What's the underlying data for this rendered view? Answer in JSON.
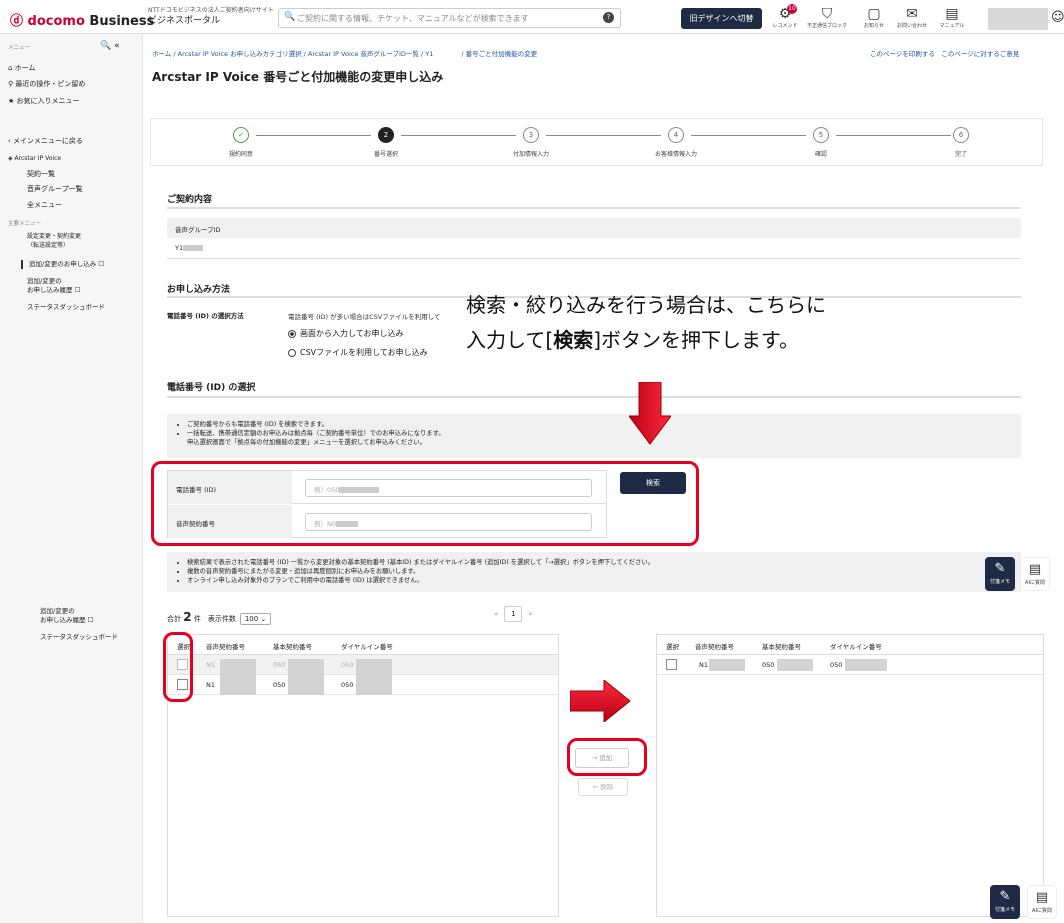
{
  "header": {
    "brand": "docomo",
    "brand_suffix": "Business",
    "tagline": "NTTドコモビジネスの法人ご契約者向けサイト",
    "portal": "ビジネスポータル",
    "search_placeholder": "ご契約に関する情報、チケット、マニュアルなどが検索できます",
    "old_design": "旧デザインへ切替",
    "icons": [
      {
        "label": "レコメンド",
        "icon": "gear-icon",
        "badge": "10"
      },
      {
        "label": "不正通信ブロック",
        "icon": "shield-icon"
      },
      {
        "label": "お知らせ",
        "icon": "book-icon"
      },
      {
        "label": "お問い合わせ",
        "icon": "mail-icon"
      },
      {
        "label": "マニュアル",
        "icon": "manual-icon"
      }
    ]
  },
  "sidebar": {
    "menu": "メニュー",
    "home": "ホーム",
    "recent": "最近の操作・ピン留め",
    "favorites": "お気に入りメニュー",
    "back": "メインメニューに戻る",
    "product": "Arcstar IP Voice",
    "items": [
      "契約一覧",
      "音声グループ一覧",
      "全メニュー"
    ],
    "section": "主要メニュー",
    "main_items": [
      "設定変更・契約変更",
      "（転送設定等）",
      "追加/変更のお申し込み ☐",
      "追加/変更の",
      "お申し込み履歴 ☐",
      "ステータスダッシュボード"
    ],
    "lower": [
      "追加/変更の",
      "お申し込み履歴 ☐",
      "ステータスダッシュボード"
    ]
  },
  "breadcrumb": "ホーム / Arcstar IP Voice お申し込みカテゴリ選択 / Arcstar IP Voice 音声グループID一覧 / Y1　　　　 / 番号ごと付加機能の変更",
  "top_links": [
    "このページを印刷する",
    "このページに対するご意見"
  ],
  "title": "Arcstar IP Voice 番号ごと付加機能の変更申し込み",
  "steps": [
    {
      "n": "✓",
      "label": "規約同意"
    },
    {
      "n": "2",
      "label": "番号選択"
    },
    {
      "n": "3",
      "label": "付加情報入力"
    },
    {
      "n": "4",
      "label": "お客様情報入力"
    },
    {
      "n": "5",
      "label": "確認"
    },
    {
      "n": "6",
      "label": "完了"
    }
  ],
  "contract": {
    "heading": "ご契約内容",
    "field": "音声グループID",
    "value": "Y1"
  },
  "method": {
    "heading": "お申し込み方法",
    "label": "電話番号 (ID) の選択方法",
    "desc": "電話番号 (ID) が多い場合はCSVファイルを利用して",
    "opt1": "画面から入力してお申し込み",
    "opt2": "CSVファイルを利用してお申し込み"
  },
  "callout": {
    "line1": "検索・絞り込みを行う場合は、こちらに",
    "line2a": "入力して[",
    "line2b": "検索",
    "line2c": "]ボタンを押下します。"
  },
  "select": {
    "heading": "電話番号 (ID) の選択",
    "notes": [
      "ご契約番号からも電話番号 (ID) を検索できます。",
      "一括転送、携帯通信定額のお申込みは拠点毎（ご契約番号単位）でのお申込みになります。",
      "申込選択画面で「拠点毎の付加機能の変更」メニューを選択してお申込みください。"
    ],
    "phone_label": "電話番号 (ID)",
    "phone_ph": "例）050",
    "voice_label": "音声契約番号",
    "voice_ph": "例）N0",
    "search_btn": "検索"
  },
  "results": {
    "notes": [
      "検索結果で表示された電話番号 (ID) 一覧から変更対象の基本契約番号 (基本ID) またはダイヤルイン番号 (追加ID) を選択して「→選択」ボタンを押下してください。",
      "複数の音声契約番号にまたがる変更・追加は再度個別にお申込みをお願いします。",
      "オンライン申し込み対象外のプランでご利用中の電話番号 (ID) は選択できません。"
    ],
    "total_label": "合計",
    "total": "2",
    "total_unit": "件",
    "per_page_label": "表示件数",
    "per_page": "100",
    "page": "1",
    "cols": [
      "選択",
      "音声契約番号",
      "基本契約番号",
      "ダイヤルイン番号"
    ],
    "rows": [
      [
        "N1",
        "050",
        "050"
      ],
      [
        "N1",
        "050",
        "050"
      ]
    ],
    "right_rows": [
      [
        "N1",
        "050",
        "050"
      ]
    ],
    "add": "→ 追加",
    "remove": "← 削除"
  },
  "float": {
    "memo": "付箋メモ",
    "ai": "AIに質問"
  }
}
